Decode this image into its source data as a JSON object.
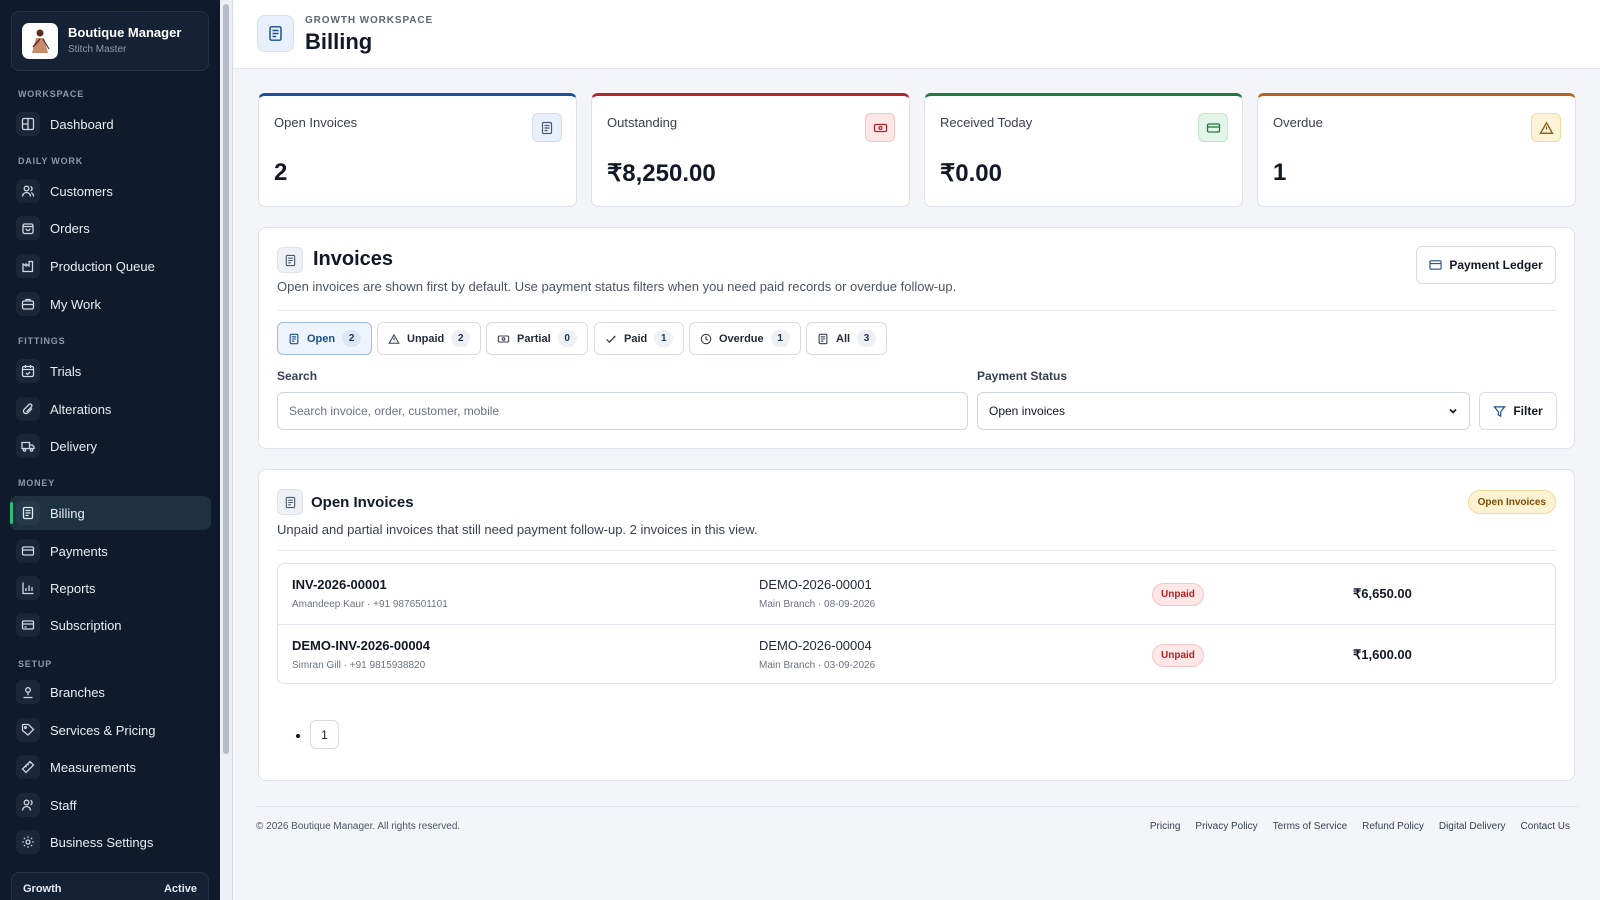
{
  "brand": {
    "title": "Boutique Manager",
    "subtitle": "Stitch Master"
  },
  "sidebar": {
    "sections": [
      "WORKSPACE",
      "DAILY WORK",
      "FITTINGS",
      "MONEY",
      "SETUP"
    ],
    "items": [
      {
        "label": "Dashboard",
        "icon": "grid-icon"
      },
      {
        "label": "Customers",
        "icon": "users-icon"
      },
      {
        "label": "Orders",
        "icon": "bag-icon"
      },
      {
        "label": "Production Queue",
        "icon": "factory-icon"
      },
      {
        "label": "My Work",
        "icon": "briefcase-icon"
      },
      {
        "label": "Trials",
        "icon": "calendar-icon"
      },
      {
        "label": "Alterations",
        "icon": "paperclip-icon"
      },
      {
        "label": "Delivery",
        "icon": "truck-icon"
      },
      {
        "label": "Billing",
        "icon": "receipt-icon",
        "active": true
      },
      {
        "label": "Payments",
        "icon": "card-icon"
      },
      {
        "label": "Reports",
        "icon": "bar-chart-icon"
      },
      {
        "label": "Subscription",
        "icon": "credit-card-icon"
      },
      {
        "label": "Branches",
        "icon": "map-pin-icon"
      },
      {
        "label": "Services & Pricing",
        "icon": "tag-icon"
      },
      {
        "label": "Measurements",
        "icon": "ruler-icon"
      },
      {
        "label": "Staff",
        "icon": "staff-icon"
      },
      {
        "label": "Business Settings",
        "icon": "gear-icon"
      }
    ],
    "plan": {
      "name": "Growth",
      "status": "Active"
    }
  },
  "header": {
    "eyebrow": "GROWTH WORKSPACE",
    "title": "Billing"
  },
  "stats": [
    {
      "label": "Open Invoices",
      "value": "2",
      "accent": "#1d4f9c",
      "icon": "receipt-icon"
    },
    {
      "label": "Outstanding",
      "value": "₹8,250.00",
      "accent": "#b3262e",
      "icon": "cash-icon"
    },
    {
      "label": "Received Today",
      "value": "₹0.00",
      "accent": "#1f7a3d",
      "icon": "card-icon"
    },
    {
      "label": "Overdue",
      "value": "1",
      "accent": "#b5651d",
      "icon": "warning-icon"
    }
  ],
  "invoices_panel": {
    "title": "Invoices",
    "description": "Open invoices are shown first by default. Use payment status filters when you need paid records or overdue follow-up.",
    "ledger_button": "Payment Ledger",
    "tabs": [
      {
        "label": "Open",
        "count": "2",
        "active": true
      },
      {
        "label": "Unpaid",
        "count": "2"
      },
      {
        "label": "Partial",
        "count": "0"
      },
      {
        "label": "Paid",
        "count": "1"
      },
      {
        "label": "Overdue",
        "count": "1"
      },
      {
        "label": "All",
        "count": "3"
      }
    ],
    "search": {
      "label": "Search",
      "placeholder": "Search invoice, order, customer, mobile"
    },
    "status": {
      "label": "Payment Status",
      "selected": "Open invoices"
    },
    "filter_button": "Filter"
  },
  "list_panel": {
    "title": "Open Invoices",
    "badge": "Open Invoices",
    "description": "Unpaid and partial invoices that still need payment follow-up. 2 invoices in this view.",
    "rows": [
      {
        "invoice": "INV-2026-00001",
        "customer": "Amandeep Kaur · +91 9876501101",
        "order": "DEMO-2026-00001",
        "branch": "Main Branch · 08-09-2026",
        "status": "Unpaid",
        "amount": "₹6,650.00"
      },
      {
        "invoice": "DEMO-INV-2026-00004",
        "customer": "Simran Gill · +91 9815938820",
        "order": "DEMO-2026-00004",
        "branch": "Main Branch · 03-09-2026",
        "status": "Unpaid",
        "amount": "₹1,600.00"
      }
    ],
    "pagination": [
      "1"
    ]
  },
  "footer": {
    "copyright": "© 2026 Boutique Manager. All rights reserved.",
    "links": [
      "Pricing",
      "Privacy Policy",
      "Terms of Service",
      "Refund Policy",
      "Digital Delivery",
      "Contact Us"
    ]
  },
  "colors": {
    "sidebar_bg": "#0f1a2a",
    "active_accent": "#2eb87a",
    "primary": "#1b4f91",
    "danger": "#b42323"
  }
}
